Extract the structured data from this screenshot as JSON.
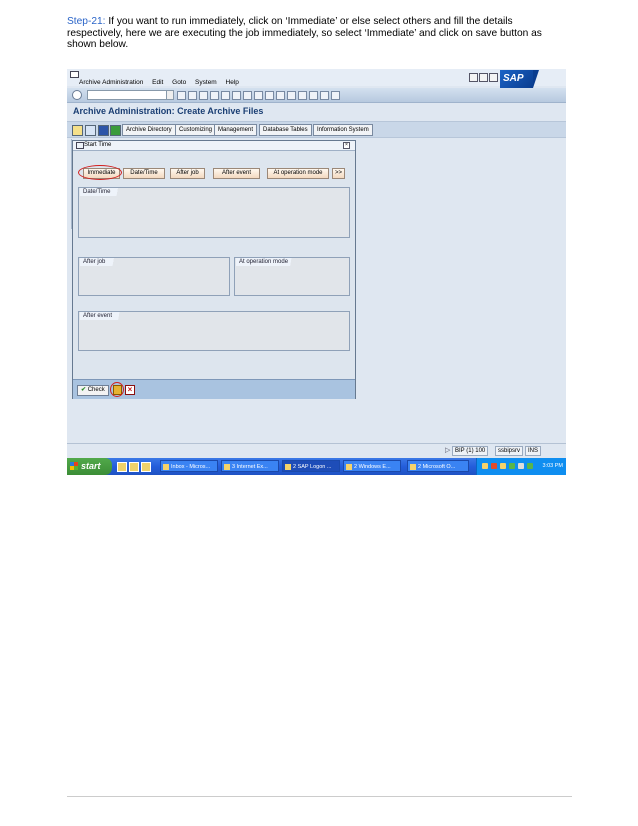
{
  "doc": {
    "step_label": "Step-21:",
    "line1": " If you want to run immediately, click on ‘Immediate’ or else select others and fill the details",
    "line2": "respectively, here we are executing the job immediately, so select ‘Immediate’ and click on save button as",
    "line3": "shown below."
  },
  "sap": {
    "menus": [
      "Archive Administration",
      "Edit",
      "Goto",
      "System",
      "Help"
    ],
    "logo": "SAP",
    "title": "Archive Administration: Create Archive Files",
    "app_buttons": [
      "Archive Directory",
      "Customizing",
      "Management",
      "Database Tables",
      "Information System"
    ],
    "dialog": {
      "title": "Start Time",
      "triggers": [
        "Immediate",
        "Date/Time",
        "After job",
        "After event",
        "At operation mode",
        ">>"
      ],
      "panels": {
        "datetime": "Date/Time",
        "afterjob": "After job",
        "opmode": "At operation mode",
        "afterevent": "After event"
      },
      "check_label": "Check"
    },
    "status": {
      "system": "BIP (1) 100",
      "server": "ssbipsrv",
      "mode": "INS"
    }
  },
  "taskbar": {
    "start": "start",
    "buttons": [
      "Inbox - Micros...",
      "3 Internet Ex...",
      "2 SAP Logon ...",
      "2 Windows E...",
      "2 Microsoft O..."
    ],
    "clock": "3:03 PM"
  },
  "colors": {
    "step": "#2a64c8",
    "highlight_ring": "#d21f1f",
    "sap_title": "#1b3f74"
  }
}
